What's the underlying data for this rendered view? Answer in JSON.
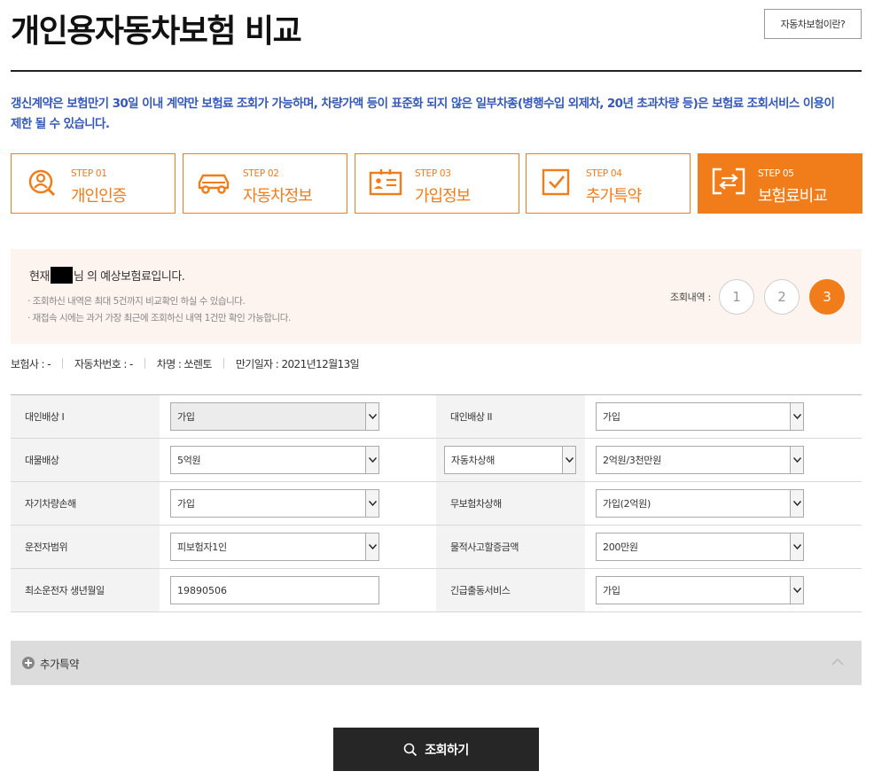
{
  "page": {
    "title": "개인용자동차보험 비교",
    "help_button": "자동차보험이란?",
    "notice": "갱신계약은 보험만기 30일 이내 계약만 보험료 조회가 가능하며, 차량가액 등이 표준화 되지 않은 일부차종(병행수입 외제차, 20년 초과차량 등)은 보험료 조회서비스 이용이 제한 될 수 있습니다."
  },
  "colors": {
    "accent": "#f07c1a",
    "notice_text": "#3559b8",
    "summary_bg": "#fef4ef",
    "dark_button": "#262626"
  },
  "steps": [
    {
      "num": "STEP 01",
      "name": "개인인증",
      "icon": "user-search-icon",
      "active": false
    },
    {
      "num": "STEP 02",
      "name": "자동차정보",
      "icon": "car-icon",
      "active": false
    },
    {
      "num": "STEP 03",
      "name": "가입정보",
      "icon": "id-card-icon",
      "active": false
    },
    {
      "num": "STEP 04",
      "name": "추가특약",
      "icon": "checkbox-icon",
      "active": false
    },
    {
      "num": "STEP 05",
      "name": "보험료비교",
      "icon": "compare-arrows-icon",
      "active": true
    }
  ],
  "summary": {
    "greeting_prefix": "현재",
    "greeting_suffix": "님 의 예상보험료입니다.",
    "note1": "· 조회하신 내역은 최대 5건까지 비교확인 하실 수 있습니다.",
    "note2": "· 재접속 시에는 과거 가장 최근에 조회하신 내역 1건만 확인 가능합니다.",
    "history_label": "조회내역 :",
    "history": [
      "1",
      "2",
      "3"
    ],
    "history_active": "3"
  },
  "info": {
    "insurer": "보험사 : -",
    "car_number": "자동차번호 : -",
    "car_name": "차명 : 쏘렌토",
    "expiry": "만기일자 : 2021년12월13일"
  },
  "coverage": {
    "rows": [
      {
        "left_label": "대인배상 I",
        "left_value": "가입",
        "right_label": "대인배상 II",
        "right_value": "가입"
      },
      {
        "left_label": "대물배상",
        "left_value": "5억원",
        "right_select": "자동차상해",
        "right_value": "2억원/3천만원"
      },
      {
        "left_label": "자기차량손해",
        "left_value": "가입",
        "right_label": "무보험차상해",
        "right_value": "가입(2억원)"
      },
      {
        "left_label": "운전자범위",
        "left_value": "피보험자1인",
        "right_label": "물적사고할증금액",
        "right_value": "200만원"
      },
      {
        "left_label": "최소운전자 생년월일",
        "left_value": "19890506",
        "right_label": "긴급출동서비스",
        "right_value": "가입"
      }
    ]
  },
  "accordion": {
    "label": "추가특약"
  },
  "search_button": "조회하기"
}
